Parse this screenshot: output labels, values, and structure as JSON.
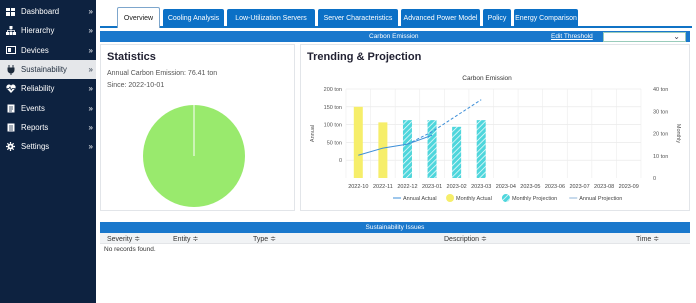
{
  "sidebar": {
    "items": [
      {
        "label": "Dashboard",
        "icon": "dashboard-icon",
        "active": false
      },
      {
        "label": "Hierarchy",
        "icon": "hierarchy-icon",
        "active": false
      },
      {
        "label": "Devices",
        "icon": "devices-icon",
        "active": false
      },
      {
        "label": "Sustainability",
        "icon": "plug-icon",
        "active": true
      },
      {
        "label": "Reliability",
        "icon": "heartbeat-icon",
        "active": false
      },
      {
        "label": "Events",
        "icon": "events-icon",
        "active": false
      },
      {
        "label": "Reports",
        "icon": "reports-icon",
        "active": false
      },
      {
        "label": "Settings",
        "icon": "gear-icon",
        "active": false
      }
    ],
    "chevron": "»"
  },
  "tabs": [
    "Overview",
    "Cooling Analysis",
    "Low-Utilization Servers",
    "Server Characteristics",
    "Advanced Power Model",
    "Policy",
    "Energy Comparison"
  ],
  "active_tab": "Overview",
  "emission_bar": {
    "title": "Carbon Emission",
    "threshold_link": "Edit Threshold",
    "select_value": ""
  },
  "statistics": {
    "title": "Statistics",
    "annual": "Annual Carbon Emission: 76.41 ton",
    "since": "Since: 2022-10-01"
  },
  "trend": {
    "title": "Trending & Projection"
  },
  "chart_data": {
    "type": "bar",
    "title": "Carbon Emission",
    "categories": [
      "2022-10",
      "2022-11",
      "2022-12",
      "2023-01",
      "2023-02",
      "2023-03",
      "2023-04",
      "2023-05",
      "2023-06",
      "2023-07",
      "2023-08",
      "2023-09"
    ],
    "left_axis": {
      "label": "Annual",
      "ticks": [
        "200 ton",
        "150 ton",
        "100 ton",
        "50 ton",
        "0"
      ],
      "range": [
        -50,
        200
      ]
    },
    "right_axis": {
      "label": "Monthly",
      "ticks": [
        "40 ton",
        "30 ton",
        "20 ton",
        "10 ton",
        "0"
      ],
      "range": [
        0,
        40
      ]
    },
    "series": [
      {
        "name": "Annual Actual",
        "kind": "line",
        "axis": "left",
        "color": "#3e8fd8",
        "values": [
          14,
          34,
          45,
          70,
          null,
          null,
          null,
          null,
          null,
          null,
          null,
          null
        ]
      },
      {
        "name": "Monthly Actual",
        "kind": "bar",
        "axis": "right",
        "color": "#f6ee6a",
        "values": [
          32,
          25,
          12,
          null,
          null,
          null,
          null,
          null,
          null,
          null,
          null,
          null
        ]
      },
      {
        "name": "Monthly Projection",
        "kind": "bar",
        "axis": "right",
        "color": "#4ed6dc",
        "pattern": "hatched",
        "values": [
          null,
          null,
          26,
          26,
          23,
          26,
          null,
          null,
          null,
          null,
          null,
          null
        ]
      },
      {
        "name": "Annual Projection",
        "kind": "dashed-line",
        "axis": "left",
        "color": "#3e8fd8",
        "values": [
          null,
          null,
          45,
          80,
          125,
          170,
          null,
          null,
          null,
          null,
          null,
          null
        ]
      }
    ]
  },
  "pie": {
    "value_fraction": 1.0,
    "color": "#99ea6d"
  },
  "issues": {
    "title": "Sustainability Issues",
    "columns": [
      "Severity ≑",
      "Entity ≑",
      "Type ≑",
      "Description ≑",
      "Time ≑"
    ],
    "empty": "No records found."
  }
}
